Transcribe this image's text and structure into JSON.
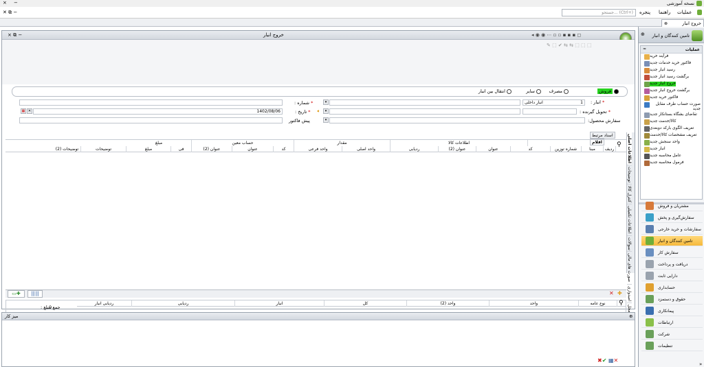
{
  "app": {
    "title": "نسخه آموزشی",
    "controls": [
      "×",
      "−"
    ]
  },
  "menubar": {
    "items": [
      "عملیات",
      "راهنما",
      "پنجره"
    ],
    "search_placeholder": "جستجو... (Ctrl+)"
  },
  "doc_tab": {
    "label": "خروج انبار"
  },
  "window": {
    "title": "خروج انبار",
    "radios": [
      "فروش",
      "مصرف",
      "سایر",
      "انتقال بین انبار"
    ],
    "selected_radio": "فروش",
    "fields": {
      "warehouse_label": "انبار :",
      "warehouse_value": "انبار داخلی",
      "warehouse_code": "1",
      "number_label": "شماره :",
      "receiver_label": "تحویل گیرنده :",
      "date_label": "تاریخ :",
      "date_value": "1402/08/06",
      "product_order_label": "سفارش محصول:",
      "invoice_label": "پیش فاکتور"
    },
    "vertical_tabs": [
      "اطلاعات اصلی",
      "توضیحات",
      "کنترل کالا",
      "اطلاعات تکمیلی",
      "سوالات",
      "صورت های مالی",
      "امیدواری",
      "حواله از محل"
    ],
    "grid_tabs": [
      "اقلام",
      "اسناد مرتبط"
    ],
    "grid_group_headers": [
      "مبلغ",
      "حساب معین",
      "مقدار",
      "اطلاعات کالا"
    ],
    "grid_columns": [
      "ردیف",
      "مبنا",
      "شماره توزین",
      "کد",
      "عنوان",
      "عنوان (2)",
      "ردیابی",
      "واحد اصلی",
      "واحد فرعی",
      "کد",
      "عنوان",
      "عنوان (2)",
      "فی",
      "مبلغ",
      "توضیحات",
      "توضیحات (2)"
    ],
    "lower_columns": [
      "نوع عامه",
      "واحد",
      "واحد (2)",
      "کل",
      "انبار",
      "ردیابی",
      "ردیابی انبار"
    ],
    "lower_total_label": "جمع مبلغ :",
    "lower_total_value": "0",
    "bottom_panel_title": "میز کار"
  },
  "sidebar": {
    "header": "تامین کنندگان و انبار",
    "ops_title": "عملیات",
    "ops": [
      {
        "label": "فرآیند خرید",
        "color": "#e8b04a"
      },
      {
        "label": "فاکتور خرید خدمات جدید",
        "color": "#7a8fb7"
      },
      {
        "label": "رسید انبار جدید",
        "color": "#d98b3b"
      },
      {
        "label": "برگشت رسید انبار جدید",
        "color": "#c24f3a"
      },
      {
        "label": "خروج انبار جدید",
        "color": "#6fa34a"
      },
      {
        "label": "برگشت خروج انبار جدید",
        "color": "#b55d9e"
      },
      {
        "label": "فاکتور خرید جدید",
        "color": "#d6a23a"
      },
      {
        "label": "صورت حساب طرف مقابل جدید",
        "color": "#3c7bc4"
      },
      {
        "label": "تقاضای بشگاه بستانکار جدید",
        "color": "#8d9bb0"
      },
      {
        "label": "کالا/خدمت جدید",
        "color": "#caa24a"
      },
      {
        "label": "تعریف الگوی بارکد دوبعدی",
        "color": "#666666"
      },
      {
        "label": "تعریف مشخصات کالا/خدمت",
        "color": "#a08a3a"
      },
      {
        "label": "واحد سنجش جدید",
        "color": "#8ab04a"
      },
      {
        "label": "انبار جدید",
        "color": "#d6b94a"
      },
      {
        "label": "عامل محاسبه جدید",
        "color": "#555555"
      },
      {
        "label": "فرمول محاسبه جدید",
        "color": "#b06a3a"
      }
    ],
    "active_op": "خروج انبار جدید",
    "nav": [
      {
        "label": "مشتریان و فروش",
        "color": "#d77a3a"
      },
      {
        "label": "سفارش‌گیری و پخش",
        "color": "#3aa0c8"
      },
      {
        "label": "سفارشات و خرید خارجی",
        "color": "#5a7fb0"
      },
      {
        "label": "تامین کنندگان و انبار",
        "color": "#6fae3a"
      },
      {
        "label": "سفارش کار",
        "color": "#6a8fc0"
      },
      {
        "label": "دریافت و پرداخت",
        "color": "#9aa3ae"
      },
      {
        "label": "دارایی ثابت",
        "color": "#9aa3ae"
      },
      {
        "label": "حسابداری",
        "color": "#e0a030"
      },
      {
        "label": "حقوق و دستمزد",
        "color": "#6aa05a"
      },
      {
        "label": "پیمانکاری",
        "color": "#3a6fb0"
      },
      {
        "label": "ارتباطات",
        "color": "#8ac04a"
      },
      {
        "label": "شرکت",
        "color": "#6aa05a"
      },
      {
        "label": "تنظیمات",
        "color": "#6aa05a"
      }
    ],
    "active_nav": "تامین کنندگان و انبار"
  }
}
